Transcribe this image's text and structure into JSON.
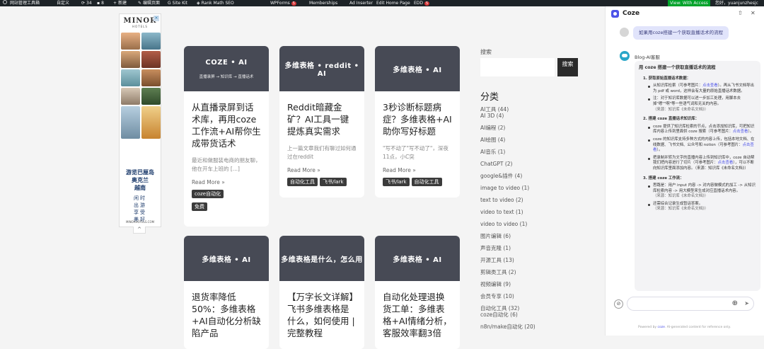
{
  "adminbar": {
    "items": [
      "网站管理工具箱",
      "自定义",
      "34",
      "8",
      "新建",
      "编辑页面",
      "Site Kit",
      "Rank Math SEO",
      "WPForms",
      "Memberships",
      "Ad Inserter",
      "Edit Home Page",
      "EDD"
    ],
    "wpforms_badge": "5",
    "edd_badge": "5",
    "view_access": "View: With Access",
    "greeting": "您好，yuanjunzhesjc"
  },
  "ad": {
    "brand": "MINOR",
    "brand_sub": "HOTELS",
    "title_lines": [
      "游览巴厘岛",
      "奥克兰",
      "越南"
    ],
    "slogan_lines": [
      "闲时",
      "出游",
      "享受",
      "美好"
    ],
    "url": "MINORHOTELS.COM",
    "collapse_icon": "^"
  },
  "cards": [
    {
      "banner_title": "COZE • AI",
      "banner_sub": "直播录屏 → 知识库 → 直播话术",
      "title": "从直播录屏到话术库，再用coze工作流+AI帮你生成带货话术",
      "excerpt": "最近和做服装电商的朋友聊，他在开车上班的 [...]",
      "more": "Read More »",
      "tags": [
        "coze自动化",
        "免费"
      ]
    },
    {
      "banner_title": "多维表格 • reddit • AI",
      "banner_sub": "",
      "title": "Reddit暗藏金矿？AI工具一键提炼真实需求",
      "excerpt": "上一篇文章我们有聊过如何通过在reddit",
      "more": "Read More »",
      "tags": [
        "自动化工具",
        "飞书/lark"
      ]
    },
    {
      "banner_title": "多维表格 • AI",
      "banner_sub": "",
      "title": "3秒诊断标题病症？多维表格+AI助你写好标题",
      "excerpt": "\"写不动了\"写不动了\"，深夜11点，小C突",
      "more": "Read More »",
      "tags": [
        "飞书/lark",
        "自动化工具"
      ]
    },
    {
      "banner_title": "多维表格 • AI",
      "banner_sub": "",
      "title": "退货率降低50%：多维表格+AI自动化分析缺陷产品",
      "excerpt": "",
      "more": "",
      "tags": []
    },
    {
      "banner_title": "多维表格是什么，怎么用",
      "banner_sub": "",
      "title": "【万字长文详解】飞书多维表格是什么，如何使用 | 完整教程",
      "excerpt": "",
      "more": "",
      "tags": []
    },
    {
      "banner_title": "多维表格 • AI",
      "banner_sub": "",
      "title": "自动化处理退换货工单：多维表格+AI情绪分析，客服效率翻3倍",
      "excerpt": "",
      "more": "",
      "tags": []
    }
  ],
  "sidebar": {
    "search_label": "搜索",
    "search_button": "搜索",
    "categories_title": "分类",
    "categories": [
      "AI工具 (44)",
      "AI 3D (4)",
      "AI编程 (2)",
      "AI绘图 (4)",
      "AI音乐 (1)",
      "ChatGPT (2)",
      "google&插件 (4)",
      "image to video (1)",
      "text to video (2)",
      "video to text (1)",
      "video to video (1)",
      "图片编辑 (6)",
      "声音克隆 (1)",
      "开源工具 (13)",
      "剪辑类工具 (2)",
      "视频编辑 (9)",
      "会员专享 (10)",
      "自动化工具 (32)",
      "coze自动化 (6)",
      "n8n/make自动化 (20)"
    ]
  },
  "coze": {
    "title": "Coze",
    "user_message": "如果用coze搭建一个获取直播话术的流程",
    "bot_name": "Blog-AI客服",
    "answer_heading": "用 coze 搭建一个获取直播话术的流程",
    "step1": "1. 获取原始直播话术数据：",
    "step1_items": [
      {
        "text": "从知识库检索（可参考图片：",
        "link": "点击查看",
        "rest": "）。再从飞书文档导出为 pdf 或 word，这样会有大量的原始直播话术数据。"
      },
      {
        "text": "注：对于知识库数据可以进一步加工处理，用脚本去掉\"嗯\"\"啊\"等一些语气词和无关的内容。",
        "link": "",
        "rest": "（来源：知识库《未命名文档》）"
      }
    ],
    "step2": "2. 搭建 coze 直播话术知识库：",
    "step2_items": [
      {
        "text": "coze 提供了知识库检索的节点，点击添加知识库，可把知识库内容上传到里面供 coze 搜索（可参考图片：",
        "link": "点击查看",
        "rest": "）。"
      },
      {
        "text": "coze 的知识库支持多种方式的内容上传，包括本地文档、在线数据、飞书文档、公众号和 notion（可参考图片：",
        "link": "点击查看",
        "rest": "）。"
      },
      {
        "text": "把录制并转为文字的直播内容上传到知识库中，coze 自动帮我们把内容进行了切片（可参考图片：",
        "link": "点击查看",
        "rest": "），可以不断向知识库里面添加内容。（来源：知识库《未命名文档》）"
      }
    ],
    "step3": "3. 搭建 coze 工作流：",
    "step3_items": [
      {
        "text": "思路是：用户 input 内容 -> 对内容做模式的加工 -> 从知识库检索内容 -> 用大模型来生成对应直播话术内容。",
        "link": "",
        "rest": "（来源：知识库《未命名文档》）"
      },
      {
        "text": "还需综合记录生成暂话答案。",
        "link": "",
        "rest": "（来源：知识库《未命名文档》）"
      }
    ],
    "footer_prefix": "Powered by",
    "footer_brand": "coze",
    "footer_suffix": ". AI-generated content for reference only."
  }
}
